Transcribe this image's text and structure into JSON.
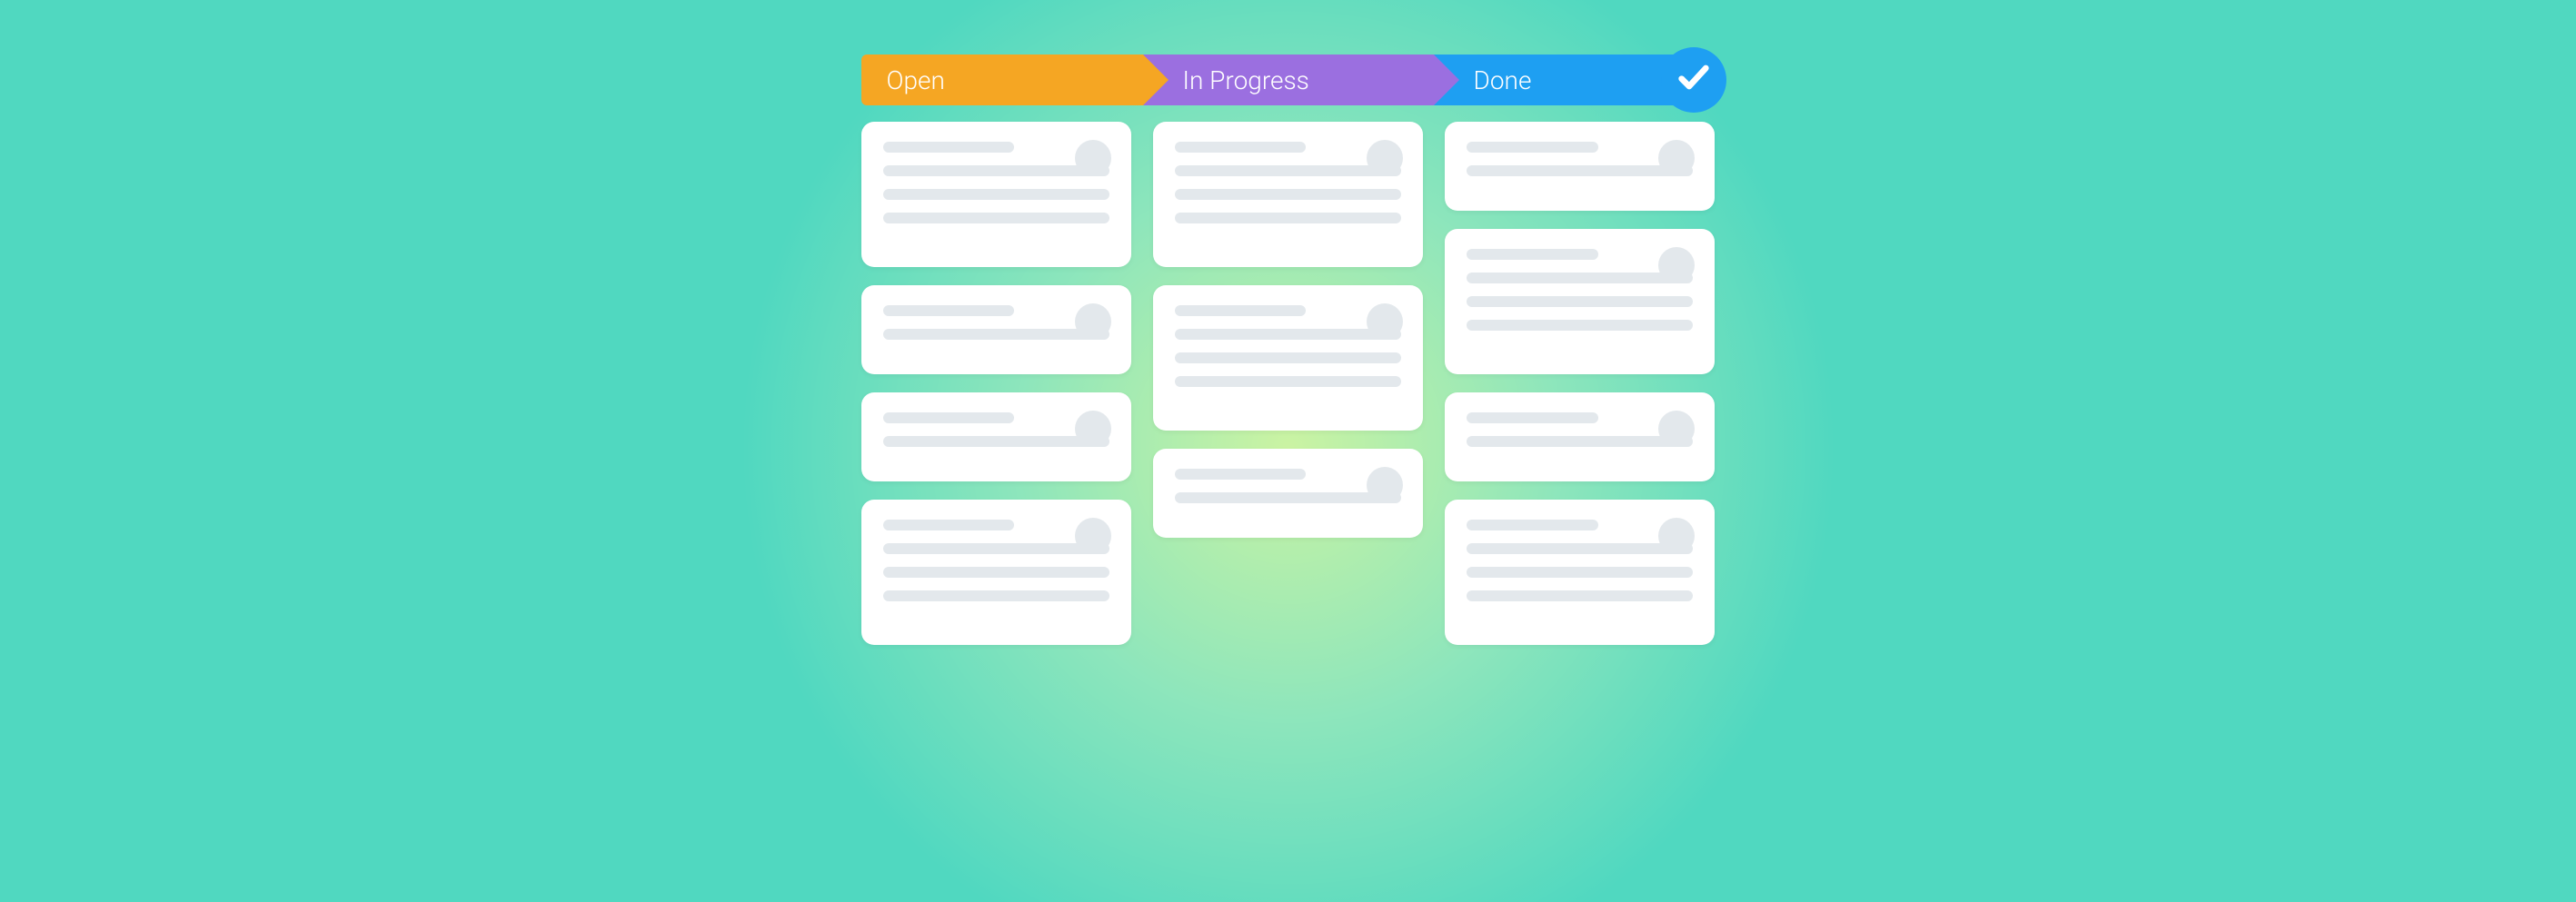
{
  "board": {
    "steps": [
      {
        "id": "open",
        "label": "Open",
        "color": "#f5a623"
      },
      {
        "id": "in_progress",
        "label": "In Progress",
        "color": "#9b6fe0"
      },
      {
        "id": "done",
        "label": "Done",
        "color": "#1e9ff2",
        "badge_icon": "checkmark-icon"
      }
    ],
    "columns": {
      "open": {
        "cards": [
          {
            "size": "large",
            "lines": 4
          },
          {
            "size": "small",
            "lines": 2
          },
          {
            "size": "small",
            "lines": 2
          },
          {
            "size": "large",
            "lines": 4
          }
        ]
      },
      "in_progress": {
        "cards": [
          {
            "size": "large",
            "lines": 4
          },
          {
            "size": "large",
            "lines": 4
          },
          {
            "size": "small",
            "lines": 2
          }
        ]
      },
      "done": {
        "cards": [
          {
            "size": "small",
            "lines": 2
          },
          {
            "size": "large",
            "lines": 4
          },
          {
            "size": "small",
            "lines": 2
          },
          {
            "size": "large",
            "lines": 4
          }
        ]
      }
    }
  },
  "colors": {
    "background": "#50d8c0",
    "glow": "#f8ffb0",
    "card_bg": "#ffffff",
    "placeholder": "#e3e8ec"
  }
}
